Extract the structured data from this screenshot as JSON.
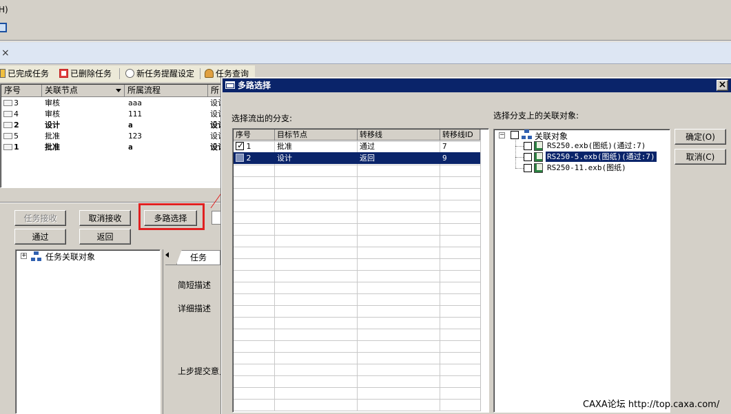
{
  "menu": {
    "partial_label": "H)"
  },
  "toolbar": {
    "items": [
      {
        "label": "已完成任务"
      },
      {
        "label": "已删除任务"
      },
      {
        "label": "新任务提醒设定"
      },
      {
        "label": "任务查询"
      }
    ]
  },
  "tab": {
    "close_glyph": "×"
  },
  "task_table": {
    "columns": [
      "序号",
      "关联节点",
      "所属流程",
      "所属"
    ],
    "rows": [
      {
        "seq": "3",
        "node": "审核",
        "flow": "aaa",
        "belong": "设计",
        "bold": false
      },
      {
        "seq": "4",
        "node": "审核",
        "flow": "111",
        "belong": "设计",
        "bold": false
      },
      {
        "seq": "2",
        "node": "设计",
        "flow": "a",
        "belong": "设计",
        "bold": true
      },
      {
        "seq": "5",
        "node": "批准",
        "flow": "123",
        "belong": "设计",
        "bold": false
      },
      {
        "seq": "1",
        "node": "批准",
        "flow": "a",
        "belong": "设计",
        "bold": true
      }
    ]
  },
  "actions": {
    "accept": "任务接收",
    "cancel_accept": "取消接收",
    "multi_select": "多路选择",
    "pass": "通过",
    "back": "返回"
  },
  "left_tree": {
    "root": "任务关联对象"
  },
  "detail": {
    "tab_label": "任务",
    "brief": "简短描述",
    "detail": "详细描述",
    "prev_submit": "上步提交意见"
  },
  "dialog": {
    "title": "多路选择",
    "close_glyph": "×",
    "branch_label": "选择流出的分支:",
    "objects_label": "选择分支上的关联对象:",
    "grid": {
      "columns": [
        "序号",
        "目标节点",
        "转移线",
        "转移线ID"
      ],
      "rows": [
        {
          "seq": "1",
          "target": "批准",
          "line": "通过",
          "line_id": "7",
          "checked": true,
          "selected": false
        },
        {
          "seq": "2",
          "target": "设计",
          "line": "返回",
          "line_id": "9",
          "checked": false,
          "selected": true
        }
      ]
    },
    "tree": {
      "root": "关联对象",
      "items": [
        {
          "label": "RS250.exb(图纸)(通过:7)",
          "selected": false
        },
        {
          "label": "RS250-5.exb(图纸)(通过:7)",
          "selected": true
        },
        {
          "label": "RS250-11.exb(图纸)",
          "selected": false
        }
      ]
    },
    "ok": "确定(O)",
    "cancel": "取消(C)"
  },
  "watermark": "CAXA论坛 http://top.caxa.com/",
  "colors": {
    "title_bar": "#0a246a",
    "highlight_box": "#e02020",
    "window_bg": "#d4d0c8"
  }
}
